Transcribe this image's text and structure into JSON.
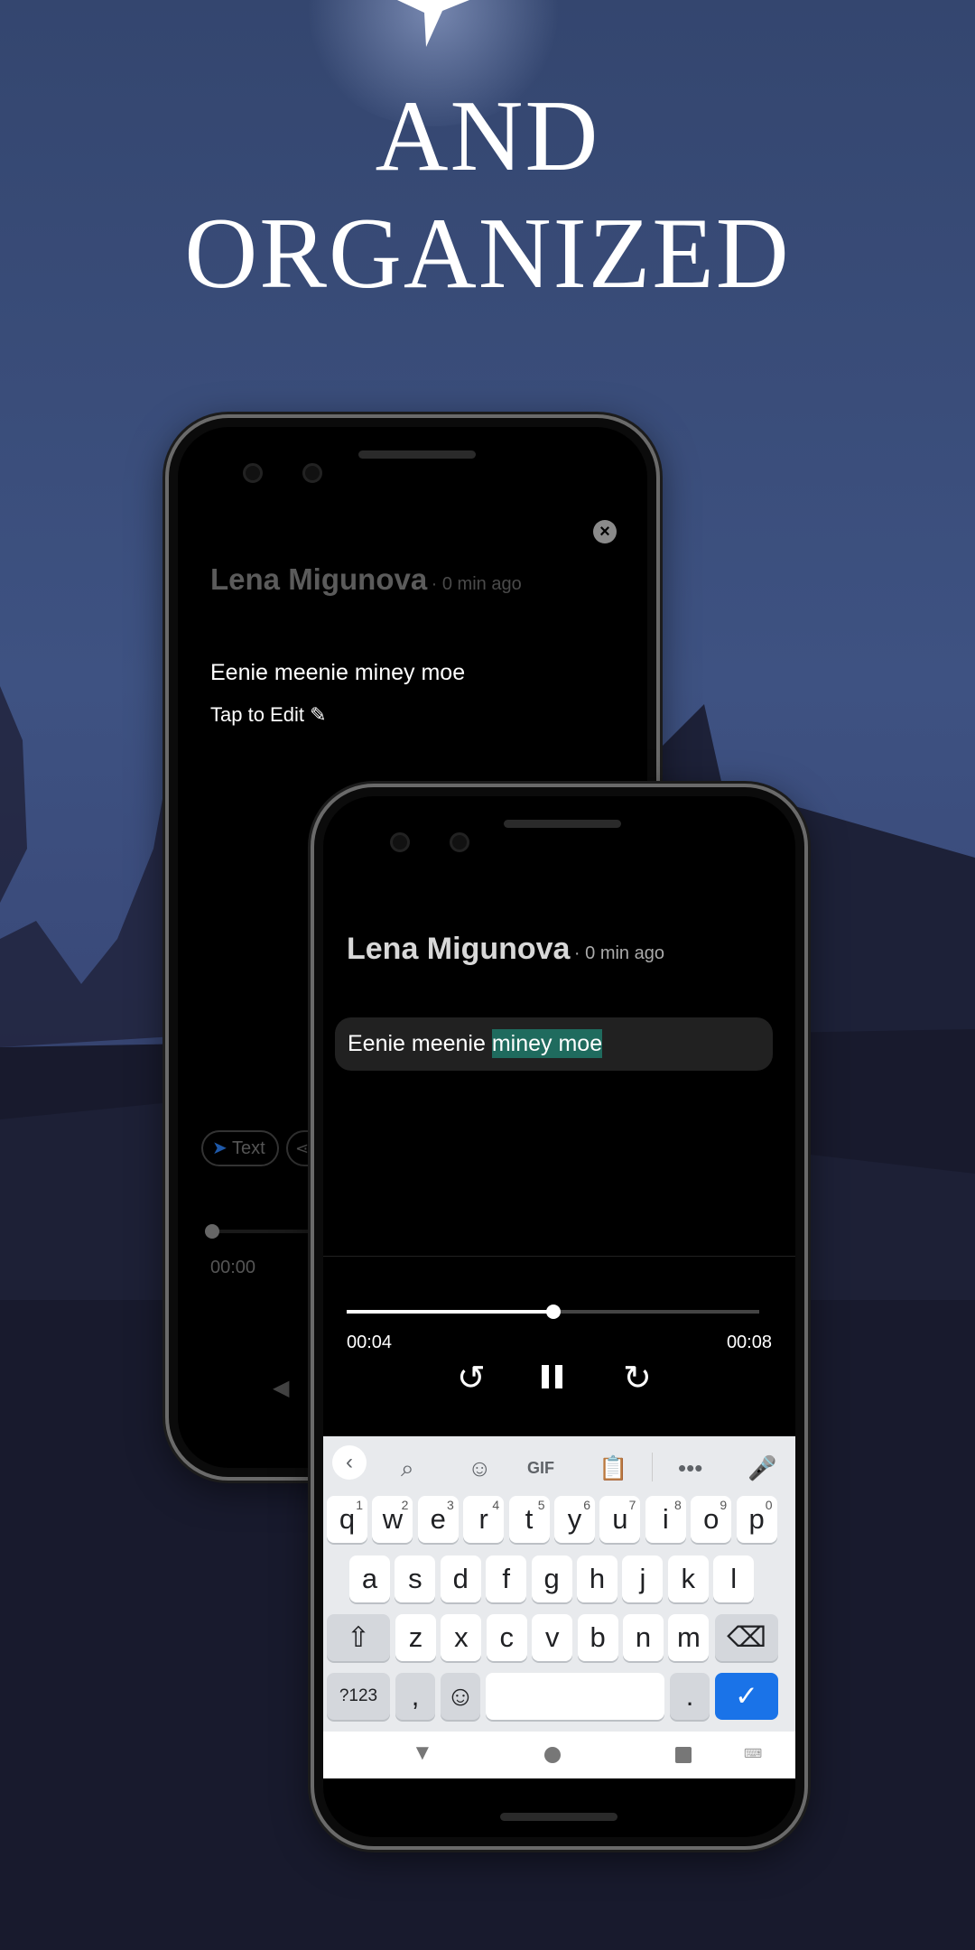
{
  "headline": {
    "line1": "AND",
    "line2": "ORGANIZED"
  },
  "back_phone": {
    "author": "Lena Migunova",
    "time": "· 0 min ago",
    "transcript": "Eenie meenie miney moe",
    "edit_label": "Tap to Edit",
    "chips": [
      {
        "label": "Text",
        "icon": "send-icon"
      },
      {
        "icon": "share-icon"
      }
    ],
    "position": "00:00"
  },
  "front_phone": {
    "author": "Lena Migunova",
    "time": "· 0 min ago",
    "transcript_plain": "Eenie meenie ",
    "transcript_highlight": "miney moe",
    "elapsed": "00:04",
    "duration": "00:08",
    "progress": 0.5,
    "highlight_color": "#1f6b5e"
  },
  "keyboard": {
    "toolbar": {
      "gif": "GIF"
    },
    "row1": [
      [
        "q",
        "1"
      ],
      [
        "w",
        "2"
      ],
      [
        "e",
        "3"
      ],
      [
        "r",
        "4"
      ],
      [
        "t",
        "5"
      ],
      [
        "y",
        "6"
      ],
      [
        "u",
        "7"
      ],
      [
        "i",
        "8"
      ],
      [
        "o",
        "9"
      ],
      [
        "p",
        "0"
      ]
    ],
    "row2": [
      "a",
      "s",
      "d",
      "f",
      "g",
      "h",
      "j",
      "k",
      "l"
    ],
    "row3": [
      "z",
      "x",
      "c",
      "v",
      "b",
      "n",
      "m"
    ],
    "symbols": "?123",
    "comma": ",",
    "period": ".",
    "accent": "#1a73e8"
  }
}
